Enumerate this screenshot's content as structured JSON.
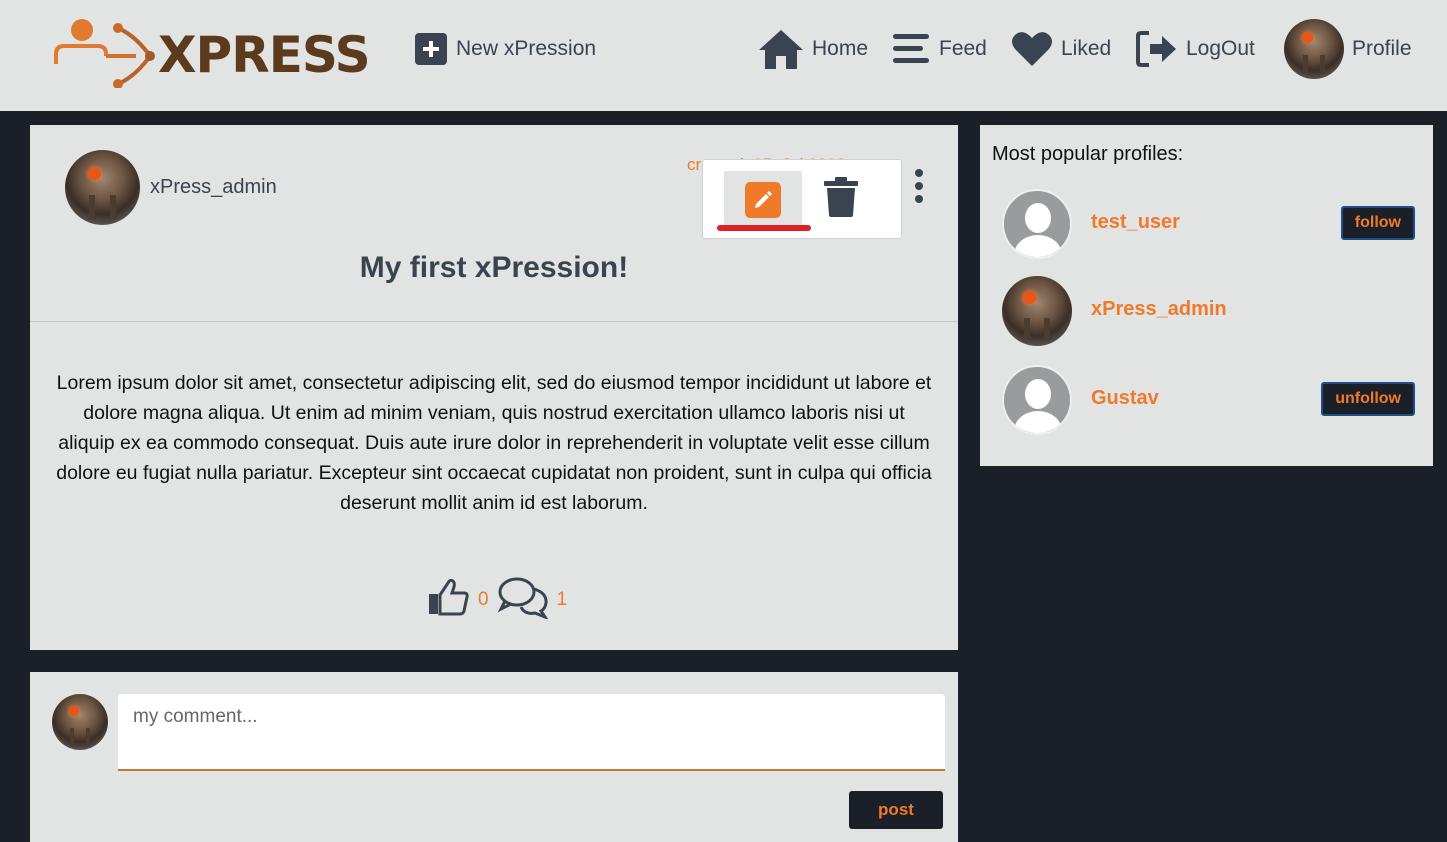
{
  "brand": {
    "logo_text": "XPRESS",
    "accent": "#ef7a2b",
    "dark": "#1b1f27"
  },
  "nav": {
    "new_label": "New xPression",
    "home_label": "Home",
    "feed_label": "Feed",
    "liked_label": "Liked",
    "logout_label": "LogOut",
    "profile_label": "Profile"
  },
  "post": {
    "author": "xPress_admin",
    "created": "created: 05. Jul 2023",
    "title": "My first xPression!",
    "body": "Lorem ipsum dolor sit amet, consectetur adipiscing elit, sed do eiusmod tempor incididunt ut labore et dolore magna aliqua. Ut enim ad minim veniam, quis nostrud exercitation ullamco laboris nisi ut aliquip ex ea commodo consequat. Duis aute irure dolor in reprehenderit in voluptate velit esse cillum dolore eu fugiat nulla pariatur. Excepteur sint occaecat cupidatat non proident, sunt in culpa qui officia deserunt mollit anim id est laborum.",
    "likes": "0",
    "comments": "1",
    "menu": {
      "edit_icon": "pencil-icon",
      "delete_icon": "trash-icon"
    }
  },
  "popular": {
    "heading": "Most popular profiles:",
    "profiles": [
      {
        "name": "test_user",
        "button": "follow"
      },
      {
        "name": "xPress_admin",
        "button": ""
      },
      {
        "name": "Gustav",
        "button": "unfollow"
      }
    ]
  },
  "comment": {
    "placeholder": "my comment...",
    "post_label": "post"
  }
}
